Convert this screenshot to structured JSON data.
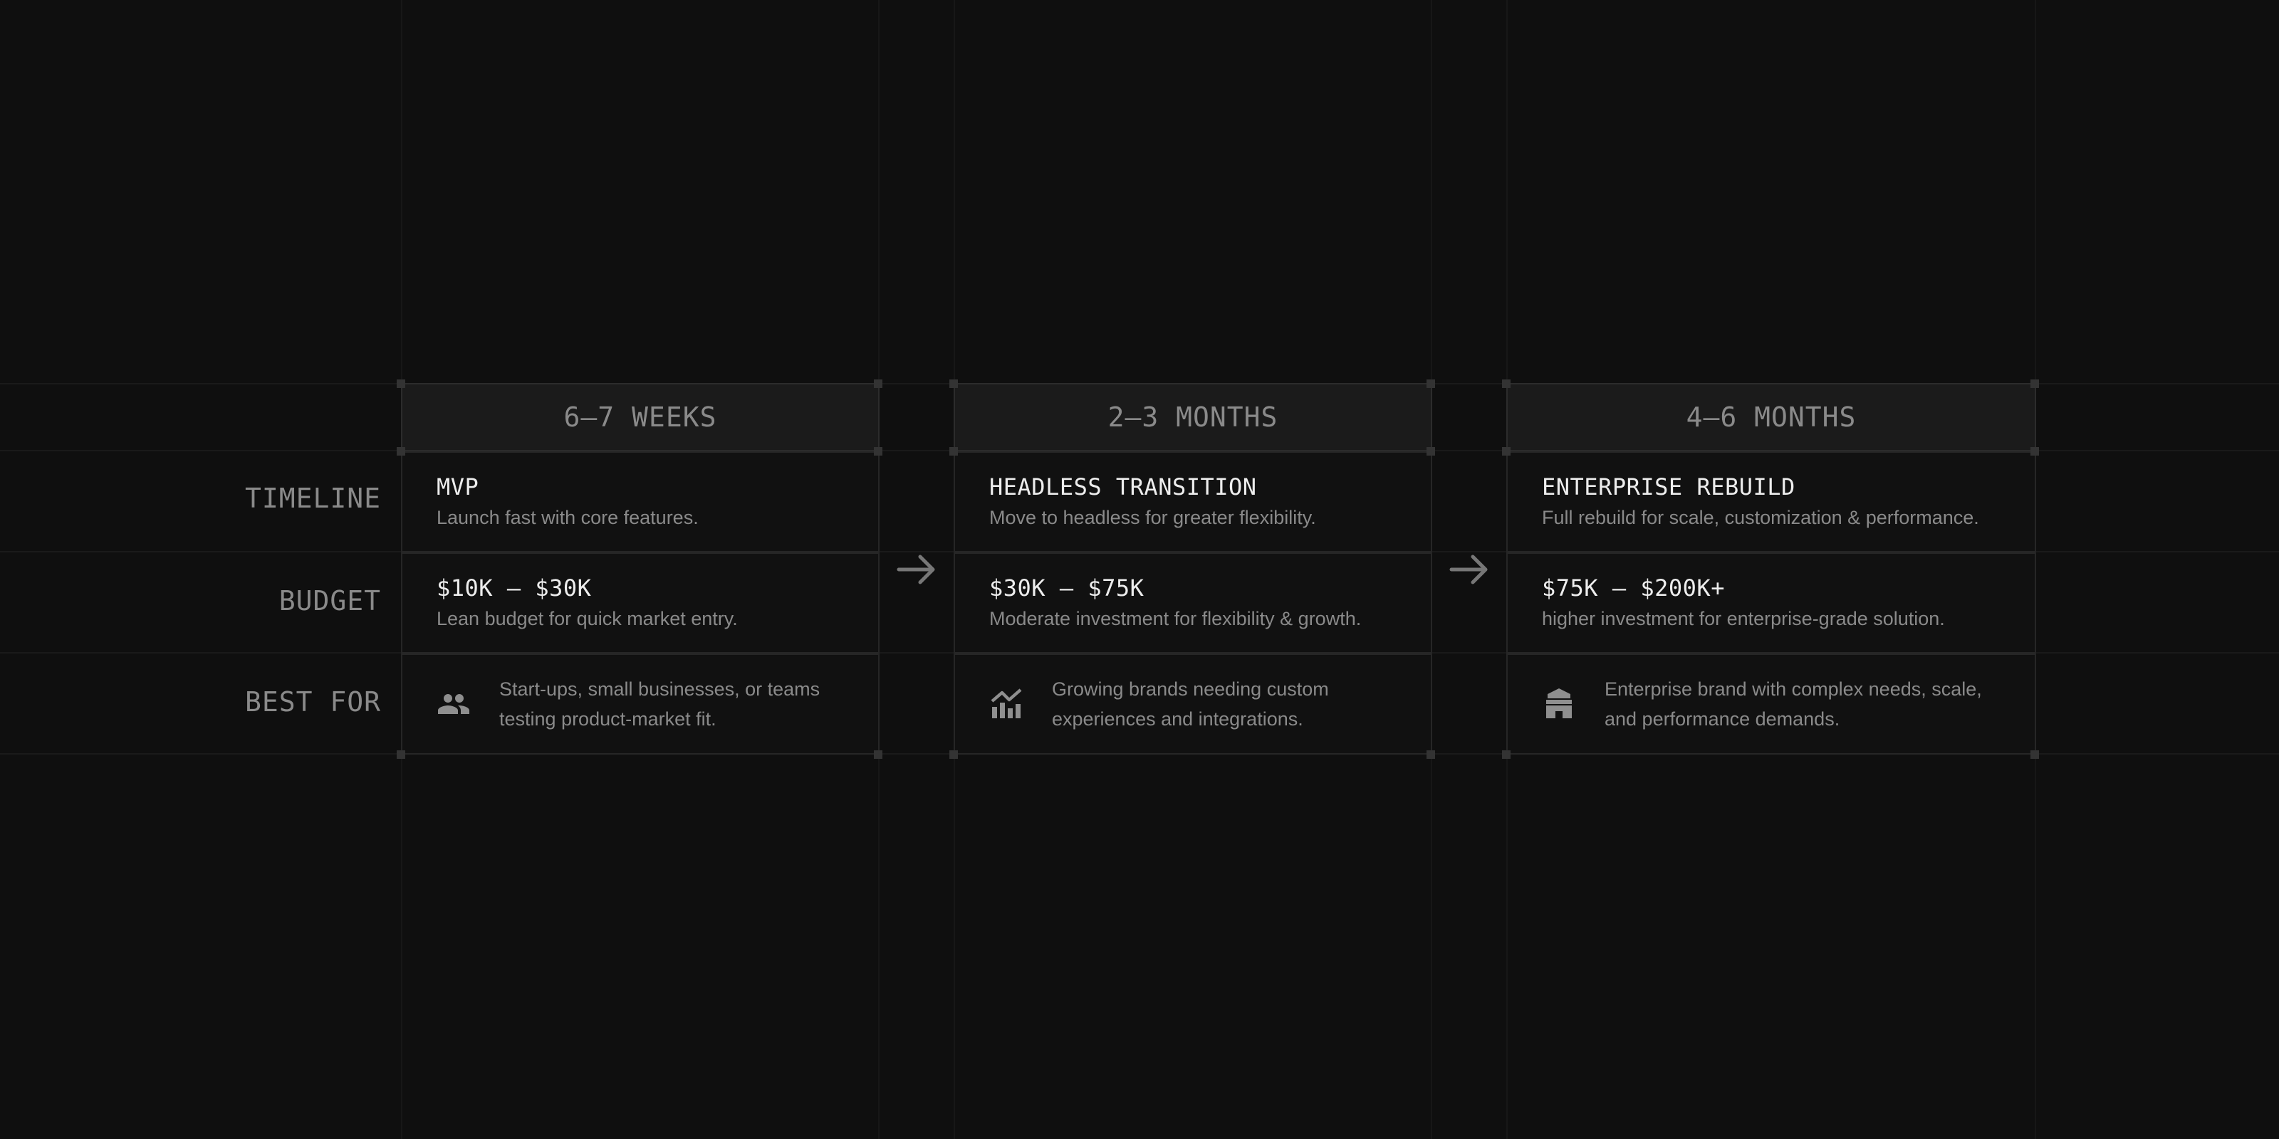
{
  "rows": {
    "timeline_label": "TIMELINE",
    "budget_label": "BUDGET",
    "best_for_label": "BEST FOR"
  },
  "columns": [
    {
      "duration": "6–7 WEEKS",
      "timeline_title": "MVP",
      "timeline_desc": "Launch fast with core features.",
      "budget_title": "$10K – $30K",
      "budget_desc": "Lean budget for quick market entry.",
      "best_for_icon": "users-icon",
      "best_for_line1": "Start-ups, small businesses, or teams",
      "best_for_line2": "testing product-market fit."
    },
    {
      "duration": "2–3 MONTHS",
      "timeline_title": "HEADLESS TRANSITION",
      "timeline_desc": "Move to headless for greater flexibility.",
      "budget_title": "$30K – $75K",
      "budget_desc": "Moderate investment for flexibility & growth.",
      "best_for_icon": "growth-chart-icon",
      "best_for_line1": "Growing brands needing custom",
      "best_for_line2": "experiences and integrations."
    },
    {
      "duration": "4–6 MONTHS",
      "timeline_title": "ENTERPRISE REBUILD",
      "timeline_desc": "Full rebuild for scale, customization & performance.",
      "budget_title": "$75K – $200K+",
      "budget_desc": "higher investment for enterprise-grade solution.",
      "best_for_icon": "enterprise-building-icon",
      "best_for_line1": "Enterprise brand with complex needs, scale,",
      "best_for_line2": "and performance demands."
    }
  ],
  "colors": {
    "background": "#0f0f0f",
    "header_bg": "#1b1b1b",
    "border": "#262626",
    "text_primary": "#ededed",
    "text_muted": "#8a8a8a"
  }
}
